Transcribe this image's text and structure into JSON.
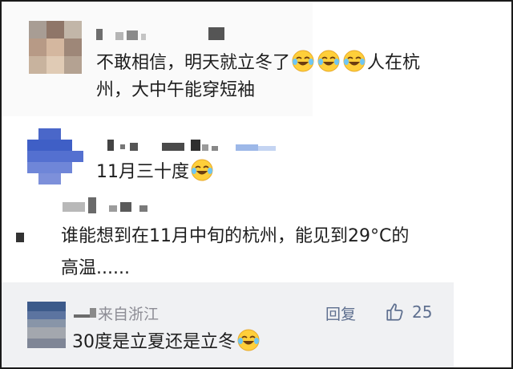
{
  "comments": [
    {
      "text_line1": "不敢相信，明天就立冬了",
      "emojis": [
        "laugh-cry",
        "laugh-cry",
        "laugh-cry"
      ],
      "text_line1_tail": "人在杭",
      "text_line2": "州，大中午能穿短袖"
    },
    {
      "text": "11月三十度",
      "emoji": "laugh-cry"
    },
    {
      "text_line1": "谁能想到在11月中旬的杭州，能见到29°C的",
      "text_line2": "高温......"
    }
  ],
  "reply": {
    "source": "来自浙江",
    "reply_label": "回复",
    "like_count": "25",
    "text": "30度是立夏还是立冬",
    "emoji": "laugh-cry"
  },
  "colors": {
    "text": "#1e1e1e",
    "meta": "#8d8d95",
    "action": "#5e6f8f",
    "reply_bg": "#f0f1f3",
    "emoji_face": "#ffcf3a"
  }
}
